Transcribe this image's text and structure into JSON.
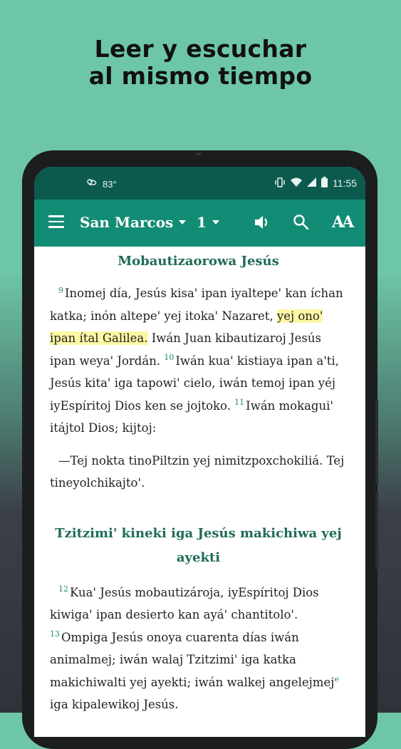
{
  "headline": {
    "line1": "Leer y escuchar",
    "line2": "al mismo tiempo"
  },
  "status_bar": {
    "temperature": "83°",
    "time": "11:55"
  },
  "toolbar": {
    "book": "San Marcos",
    "chapter": "1",
    "font_size_label": "AA"
  },
  "content": {
    "section1_title": "Mobautizaorowa Jesús",
    "v9_num": "9",
    "v9_a": "Inomej día, Jesús kisaꞌ ipan iyaltepeꞌ kan íchan katka; inón altepeꞌ yej itokaꞌ Nazaret, ",
    "v9_hl": "yej onoꞌ ipan ítal Galilea.",
    "v9_b": " Iwán Juan kibautizaroj Jesús ipan weyaꞌ Jordán. ",
    "v10_num": "10",
    "v10": "Iwán kuaꞌ kistiaya ipan aꞌti, Jesús kitaꞌ iga tapowiꞌ cielo, iwán temoj ipan yéj iyEspíritoj Dios ken se jojtoko. ",
    "v11_num": "11",
    "v11": "Iwán mokaguiꞌ itájtol Dios; kijtoj:",
    "quote": "—Tej nokta tinoPiltzin yej nimitzpoxchokiliá. Tej tineyolchikajtoꞌ.",
    "section2_title": "Tzitzimiꞌ kineki iga Jesús makichiwa yej ayekti",
    "v12_num": "12",
    "v12": "Kuaꞌ Jesús mobautizároja, iyEspíritoj Dios kiwigaꞌ ipan desierto kan ayáꞌ chantitoloꞌ. ",
    "v13_num": "13",
    "v13": "Ompiga Jesús onoya cuarenta días iwán animalmej; iwán walaj Tzitzimiꞌ iga katka makichiwalti yej ayekti; iwán walkej angelejmej",
    "note": "e",
    "v13_b": " iga kipalewikoj Jesús."
  },
  "colors": {
    "status_bar": "#0c5a4e",
    "toolbar": "#138c75",
    "section_title": "#1e6b58",
    "highlight": "#fdf7a6"
  },
  "icons": {
    "menu": "hamburger-menu-icon",
    "audio": "speaker-icon",
    "search": "search-icon",
    "font": "text-size-icon"
  }
}
